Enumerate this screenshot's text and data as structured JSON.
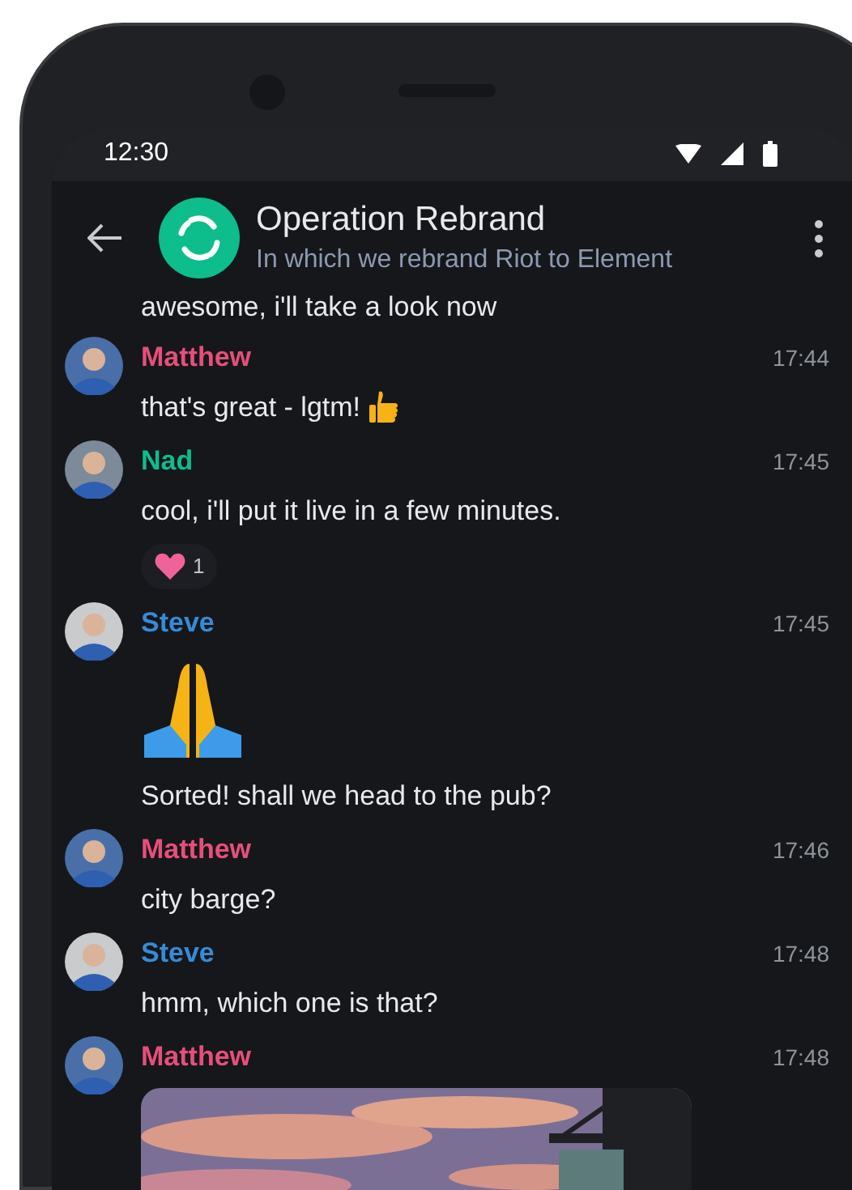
{
  "status_bar": {
    "time": "12:30"
  },
  "room": {
    "name": "Operation Rebrand",
    "topic": "In which we rebrand Riot to Element"
  },
  "timeline": [
    {
      "kind": "continuation",
      "items": [
        {
          "kind": "text",
          "text": "awesome, i'll take a look now"
        }
      ]
    },
    {
      "kind": "group",
      "sender": "Matthew",
      "color": "#e64f7a",
      "time": "17:44",
      "items": [
        {
          "kind": "text",
          "text": "that's great - lgtm!",
          "thumbs_up": true
        }
      ]
    },
    {
      "kind": "group",
      "sender": "Nad",
      "color": "#0dbd8b",
      "time": "17:45",
      "items": [
        {
          "kind": "text",
          "text": "cool, i'll put it live in a few minutes."
        },
        {
          "kind": "reaction",
          "count": "1"
        }
      ]
    },
    {
      "kind": "group",
      "sender": "Steve",
      "color": "#368bd6",
      "time": "17:45",
      "items": [
        {
          "kind": "emoji"
        },
        {
          "kind": "text",
          "text": "Sorted! shall we head to the pub?"
        }
      ]
    },
    {
      "kind": "group",
      "sender": "Matthew",
      "color": "#e64f7a",
      "time": "17:46",
      "items": [
        {
          "kind": "text",
          "text": "city barge?"
        }
      ]
    },
    {
      "kind": "group",
      "sender": "Steve",
      "color": "#368bd6",
      "time": "17:48",
      "items": [
        {
          "kind": "text",
          "text": "hmm, which one is that?"
        }
      ]
    },
    {
      "kind": "group",
      "sender": "Matthew",
      "color": "#e64f7a",
      "time": "17:48"
    }
  ]
}
